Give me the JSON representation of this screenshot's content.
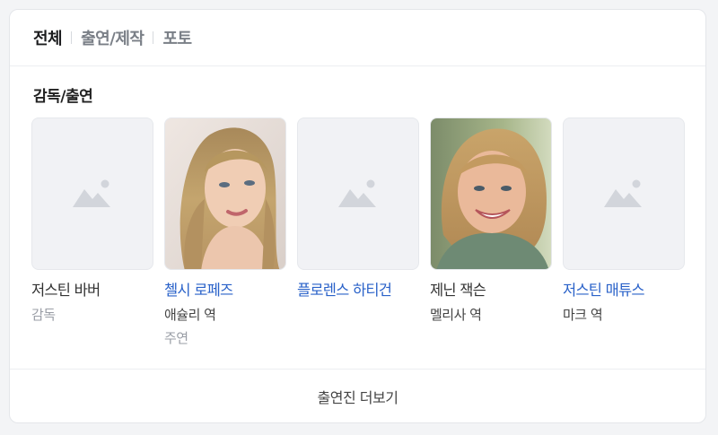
{
  "tabs": [
    {
      "label": "전체",
      "active": true
    },
    {
      "label": "출연/제작",
      "active": false
    },
    {
      "label": "포토",
      "active": false
    }
  ],
  "section_title": "감독/출연",
  "people": [
    {
      "name": "저스틴 바버",
      "role": "",
      "sub": "감독",
      "link": false,
      "image": "placeholder-image-icon"
    },
    {
      "name": "첼시 로페즈",
      "role": "애슐리 역",
      "sub": "주연",
      "link": true,
      "image": "portrait-photo-blonde-woman"
    },
    {
      "name": "플로렌스 하티건",
      "role": "",
      "sub": "",
      "link": true,
      "image": "placeholder-image-icon"
    },
    {
      "name": "제닌 잭슨",
      "role": "멜리사 역",
      "sub": "",
      "link": false,
      "image": "portrait-photo-smiling-woman"
    },
    {
      "name": "저스틴 매튜스",
      "role": "마크 역",
      "sub": "",
      "link": true,
      "image": "placeholder-image-icon"
    }
  ],
  "more_button": "출연진 더보기",
  "colors": {
    "link": "#2a62c9",
    "muted": "#9a9ea6",
    "placeholder_bg": "#f1f2f5"
  }
}
